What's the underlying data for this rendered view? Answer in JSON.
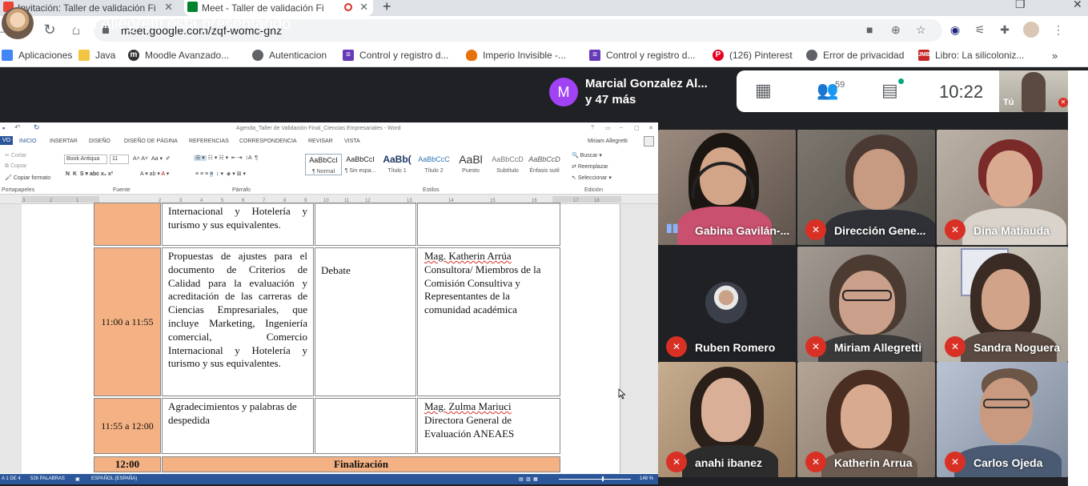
{
  "browser": {
    "tabs": [
      {
        "title": "Invitación: Taller de validación Fi",
        "active": false
      },
      {
        "title": "Meet - Taller de validación Fi",
        "active": true
      }
    ],
    "new_tab": "+",
    "url": "meet.google.com/zqf-womc-gnz",
    "bookmarks": [
      {
        "label": "Aplicaciones",
        "icon": "apps-grid-icon",
        "color": "#4285f4"
      },
      {
        "label": "Java",
        "icon": "folder-icon",
        "color": "#f4c542"
      },
      {
        "label": "Moodle Avanzado...",
        "icon": "moodle-icon",
        "color": "#333333"
      },
      {
        "label": "Autenticacion",
        "icon": "globe-icon",
        "color": "#5f6368"
      },
      {
        "label": "Control y registro d...",
        "icon": "forms-icon",
        "color": "#673ab7"
      },
      {
        "label": "Imperio Invisible -...",
        "icon": "flame-icon",
        "color": "#e8710a"
      },
      {
        "label": "Control y registro d...",
        "icon": "forms-icon",
        "color": "#673ab7"
      },
      {
        "label": "(126) Pinterest",
        "icon": "pinterest-icon",
        "color": "#e60023"
      },
      {
        "label": "Error de privacidad",
        "icon": "globe-icon",
        "color": "#5f6368"
      },
      {
        "label": "Libro: La silicoloniz...",
        "icon": "jmb-icon",
        "color": "#c62828"
      }
    ]
  },
  "meet": {
    "presenting": "Miriam Allegretti está presentando",
    "mini_name": "Marcial Gonzalez Al...",
    "mini_more": "y 47 más",
    "mini_initial": "M",
    "participants_count": "59",
    "time": "10:22",
    "self_label": "Tú",
    "participants": [
      {
        "name": "Gabina Gavilán-...",
        "muted": false,
        "bg": "#7a6a62"
      },
      {
        "name": "Dirección Gene...",
        "muted": true,
        "bg": "#6f6a63"
      },
      {
        "name": "Dina Matiauda",
        "muted": true,
        "bg": "#a89a8e"
      },
      {
        "name": "Ruben Romero",
        "muted": true,
        "bg": "#202124"
      },
      {
        "name": "Miriam Allegretti",
        "muted": true,
        "bg": "#8c8580"
      },
      {
        "name": "Sandra Noguera",
        "muted": true,
        "bg": "#c9c4bc"
      },
      {
        "name": "anahi ibanez",
        "muted": true,
        "bg": "#a58c70"
      },
      {
        "name": "Katherin Arrua",
        "muted": true,
        "bg": "#9a8a7c"
      },
      {
        "name": "Carlos Ojeda",
        "muted": true,
        "bg": "#9aa6b8"
      }
    ]
  },
  "word": {
    "title": "Agenda_Taller de Validación Final_Ciencias Empresariales - Word",
    "tabs": [
      "VO",
      "INICIO",
      "INSERTAR",
      "DISEÑO",
      "DISEÑO DE PÁGINA",
      "REFERENCIAS",
      "CORRESPONDENCIA",
      "REVISAR",
      "VISTA"
    ],
    "user": "Miriam Allegretti",
    "clipboard": {
      "cut": "Cortar",
      "copy": "Copiar",
      "format": "Copiar formato",
      "group": "Portapapeles"
    },
    "font": {
      "name": "Book Antiqua",
      "size": "11",
      "group": "Fuente"
    },
    "paragraph_group": "Párrafo",
    "styles": [
      {
        "preview": "AaBbCcI",
        "name": "¶ Normal"
      },
      {
        "preview": "AaBbCcI",
        "name": "¶ Sin espa..."
      },
      {
        "preview": "AaBb(",
        "name": "Título 1"
      },
      {
        "preview": "AaBbCcC",
        "name": "Título 2"
      },
      {
        "preview": "AaBl",
        "name": "Puesto"
      },
      {
        "preview": "AaBbCcD",
        "name": "Subtítulo"
      },
      {
        "preview": "AaBbCcD",
        "name": "Énfasis sutil"
      }
    ],
    "styles_group": "Estilos",
    "edit": {
      "find": "Buscar",
      "replace": "Reemplazar",
      "select": "Seleccionar",
      "group": "Edición"
    },
    "status": {
      "page": "A 1 DE 4",
      "words": "526 PALABRAS",
      "lang": "ESPAÑOL (ESPAÑA)",
      "zoom": "148 %"
    }
  },
  "table": {
    "row0_desc": "Internacional y Hotelería y turismo y sus equivalentes.",
    "row1": {
      "time": "11:00 a 11:55",
      "desc": "Propuestas de ajustes para el documento de Criterios de Calidad para la evaluación y acreditación de las carreras de Ciencias Empresariales, que incluye Marketing, Ingeniería comercial, Comercio Internacional y Hotelería y turismo y sus equivalentes.",
      "type": "Debate",
      "who_name": "Mag. Katherin Arrúa",
      "who_rest": "Consultora/ Miembros de la Comisión Consultiva y Representantes de la comunidad académica"
    },
    "row2": {
      "time": "11:55 a 12:00",
      "desc": "Agradecimientos y palabras de despedida",
      "type": "",
      "who_name": "Mag. Zulma Mariuci",
      "who_rest": "Directora General de Evaluación ANEAES"
    },
    "row3": {
      "time": "12:00",
      "label": "Finalización"
    }
  }
}
